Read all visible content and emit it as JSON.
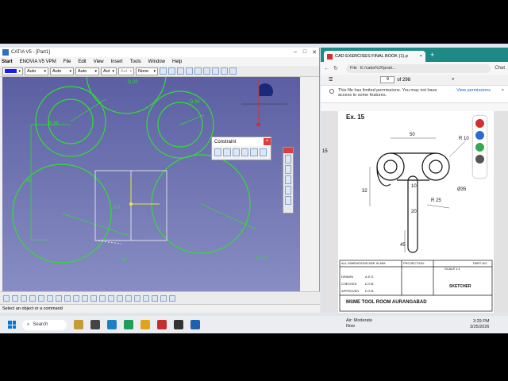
{
  "catia": {
    "title": "CATIA V5 - [Part1]",
    "menu": [
      "Start",
      "ENOVIA V5 VPM",
      "File",
      "Edit",
      "View",
      "Insert",
      "Tools",
      "Window",
      "Help"
    ],
    "toolbar": {
      "line_type": "Auto",
      "weight": "Auto",
      "pattern": "Auto",
      "layer": "Aut",
      "filter": "Aut",
      "none": "None"
    },
    "constraint_panel": {
      "title": "Constraint"
    },
    "sketch_labels": {
      "d20": "D.20",
      "d36": "D.36",
      "d50": "D.50",
      "r36": "R.36",
      "r42": "42",
      "d30": "30",
      "v0": "0.0"
    },
    "status_bar": "Select an object or a command"
  },
  "edge": {
    "tab_title": "CAD EXERCISES FINAL BOOK (1).p",
    "url_prefix": "File",
    "url": "E:/catia%20prati...",
    "chat_label": "Chat",
    "pdf_page": "9",
    "pdf_total": "of 298",
    "notice": "This file has limited permissions. You may not have access to some features.",
    "view_permissions": "View permissions",
    "side_number": "15",
    "drawing": {
      "title": "Ex. 15",
      "dims": {
        "d50": "50",
        "r10": "R 10",
        "d35": "Ø35",
        "r25": "R 25",
        "d32": "32",
        "d10": "10",
        "d20": "20",
        "d45": "45"
      },
      "note": "ALL DIMENSIONS ARE IN MM",
      "projection": "PROJECTION:",
      "scale": "SCALE 1:1",
      "part_no": "PART NO.",
      "rows": [
        "DRAWN",
        "CHECKED",
        "APPROVED"
      ],
      "names": [
        "A.K.S.",
        "D.S.B.",
        "D.S.B."
      ],
      "org": "MSME TOOL ROOM AURANGABAD",
      "sketcher": "SKETCHER"
    }
  },
  "taskbar": {
    "search": "Search",
    "weather_line1": "Air: Moderate",
    "weather_line2": "Now",
    "time": "3:29 PM",
    "date": "3/25/2026"
  }
}
